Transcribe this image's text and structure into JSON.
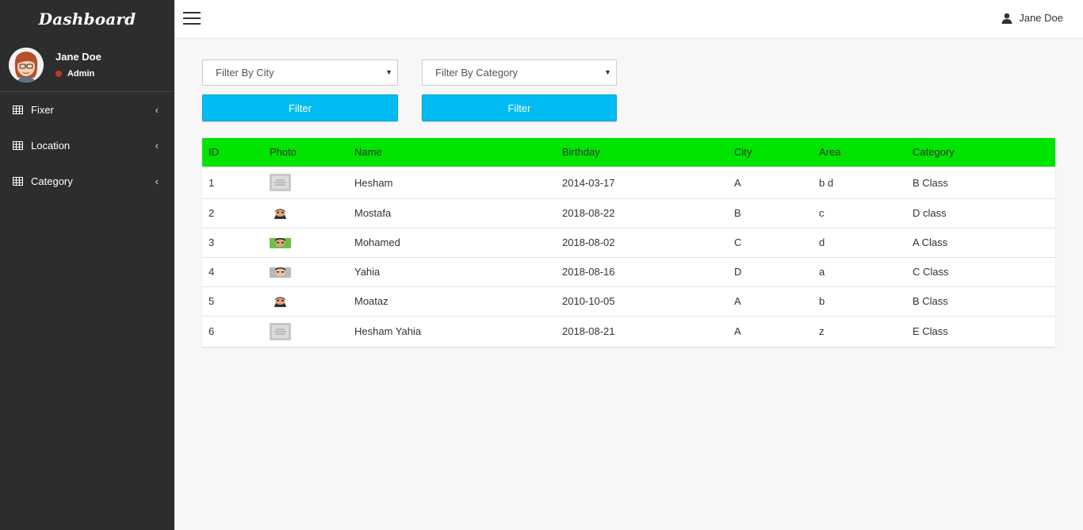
{
  "sidebar": {
    "brand": "Dashboard",
    "user_name": "Jane Doe",
    "user_role": "Admin",
    "status_color": "#c0392b",
    "items": [
      {
        "label": "Fixer",
        "icon": "table-icon"
      },
      {
        "label": "Location",
        "icon": "table-icon"
      },
      {
        "label": "Category",
        "icon": "table-icon"
      }
    ]
  },
  "topbar": {
    "user_name": "Jane Doe"
  },
  "filters": {
    "city_placeholder": "Filter By City",
    "category_placeholder": "Filter By Category",
    "city_button": "Filter",
    "category_button": "Filter",
    "accent": "#00bcf2"
  },
  "table": {
    "header_color": "#00e400",
    "columns": [
      "ID",
      "Photo",
      "Name",
      "Birthday",
      "City",
      "Area",
      "Category"
    ],
    "rows": [
      {
        "id": "1",
        "photo": "placeholder-photo",
        "name": "Hesham",
        "birthday": "2014-03-17",
        "city": "A",
        "area": "b d",
        "category": "B Class"
      },
      {
        "id": "2",
        "photo": "cartoon-face",
        "name": "Mostafa",
        "birthday": "2018-08-22",
        "city": "B",
        "area": "c",
        "category": "D class"
      },
      {
        "id": "3",
        "photo": "cartoon-face-green",
        "name": "Mohamed",
        "birthday": "2018-08-02",
        "city": "C",
        "area": "d",
        "category": "A Class"
      },
      {
        "id": "4",
        "photo": "cartoon-face",
        "name": "Yahia",
        "birthday": "2018-08-16",
        "city": "D",
        "area": "a",
        "category": "C Class"
      },
      {
        "id": "5",
        "photo": "cartoon-face",
        "name": "Moataz",
        "birthday": "2010-10-05",
        "city": "A",
        "area": "b",
        "category": "B Class"
      },
      {
        "id": "6",
        "photo": "placeholder-photo",
        "name": "Hesham Yahia",
        "birthday": "2018-08-21",
        "city": "A",
        "area": "z",
        "category": "E Class"
      }
    ]
  }
}
